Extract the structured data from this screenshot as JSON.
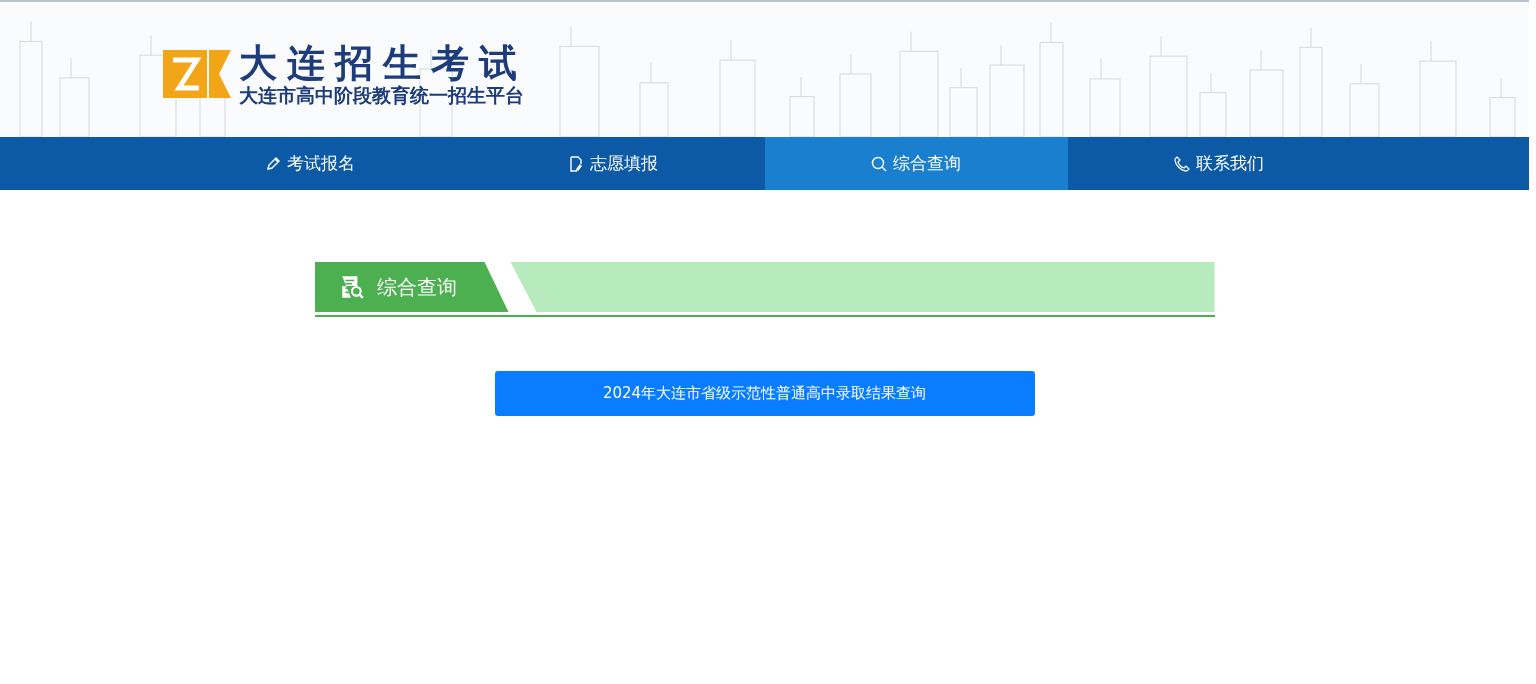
{
  "header": {
    "title": "大连招生考试",
    "subtitle": "大连市高中阶段教育统一招生平台"
  },
  "nav": [
    {
      "label": "考试报名",
      "kind": "pencil",
      "selected": false
    },
    {
      "label": "志愿填报",
      "kind": "document",
      "selected": false
    },
    {
      "label": "综合查询",
      "kind": "search",
      "selected": true
    },
    {
      "label": "联系我们",
      "kind": "phone",
      "selected": false
    }
  ],
  "section": {
    "title": "综合查询"
  },
  "links": [
    "2024年大连市省级示范性普通高中录取结果查询"
  ]
}
